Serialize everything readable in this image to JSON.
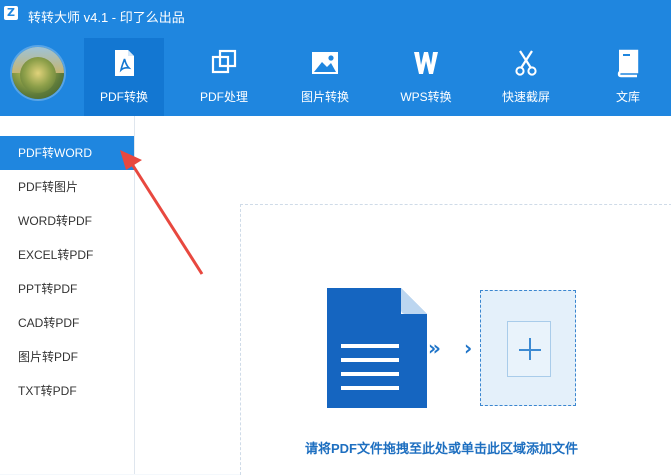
{
  "app": {
    "logo_letter": "Z",
    "title": "转转大师 v4.1 - 印了么出品"
  },
  "toolbar": {
    "tabs": [
      {
        "label": "PDF转换",
        "icon": "pdf-icon",
        "active": true
      },
      {
        "label": "PDF处理",
        "icon": "pdf-process-icon",
        "active": false
      },
      {
        "label": "图片转换",
        "icon": "image-icon",
        "active": false
      },
      {
        "label": "WPS转换",
        "icon": "wps-icon",
        "active": false
      },
      {
        "label": "快速截屏",
        "icon": "scissors-icon",
        "active": false
      },
      {
        "label": "文库",
        "icon": "library-icon",
        "active": false
      }
    ]
  },
  "sidebar": {
    "items": [
      {
        "label": "PDF转WORD",
        "active": true
      },
      {
        "label": "PDF转图片",
        "active": false
      },
      {
        "label": "WORD转PDF",
        "active": false
      },
      {
        "label": "EXCEL转PDF",
        "active": false
      },
      {
        "label": "PPT转PDF",
        "active": false
      },
      {
        "label": "CAD转PDF",
        "active": false
      },
      {
        "label": "图片转PDF",
        "active": false
      },
      {
        "label": "TXT转PDF",
        "active": false
      }
    ]
  },
  "dropzone": {
    "hint": "请将PDF文件拖拽至此处或单击此区域添加文件",
    "chevron_double": "»",
    "chevron_single": "›"
  },
  "colors": {
    "brand": "#1f86df",
    "brand_dark": "#1377d2",
    "doc_blue": "#1565c0",
    "annotation_red": "#e8483f"
  }
}
